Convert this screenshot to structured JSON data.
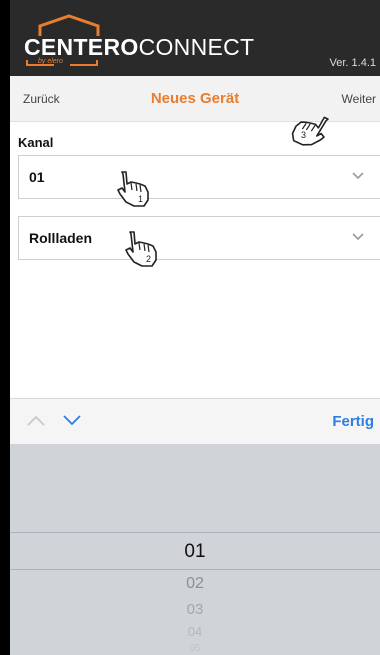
{
  "header": {
    "brand_bold": "CENTERO",
    "brand_light": "CONNECT",
    "brand_sub": "by elero",
    "version": "Ver. 1.4.1"
  },
  "nav": {
    "back_label": "Zurück",
    "title": "Neues Gerät",
    "next_label": "Weiter"
  },
  "form": {
    "channel_label": "Kanal",
    "channel_value": "01",
    "device_type_value": "Rollladen"
  },
  "annotations": {
    "step1": "1",
    "step2": "2",
    "step3": "3"
  },
  "toolbar": {
    "done_label": "Fertig"
  },
  "picker": {
    "items": [
      "01",
      "02",
      "03",
      "04",
      "05"
    ]
  },
  "colors": {
    "accent": "#e87d2e",
    "header_bg": "#2a2a2a",
    "ios_blue": "#2f7de1"
  },
  "icons": [
    "house-roof-icon",
    "chevron-down-icon",
    "pointing-hand-icon",
    "chevron-up-icon"
  ]
}
